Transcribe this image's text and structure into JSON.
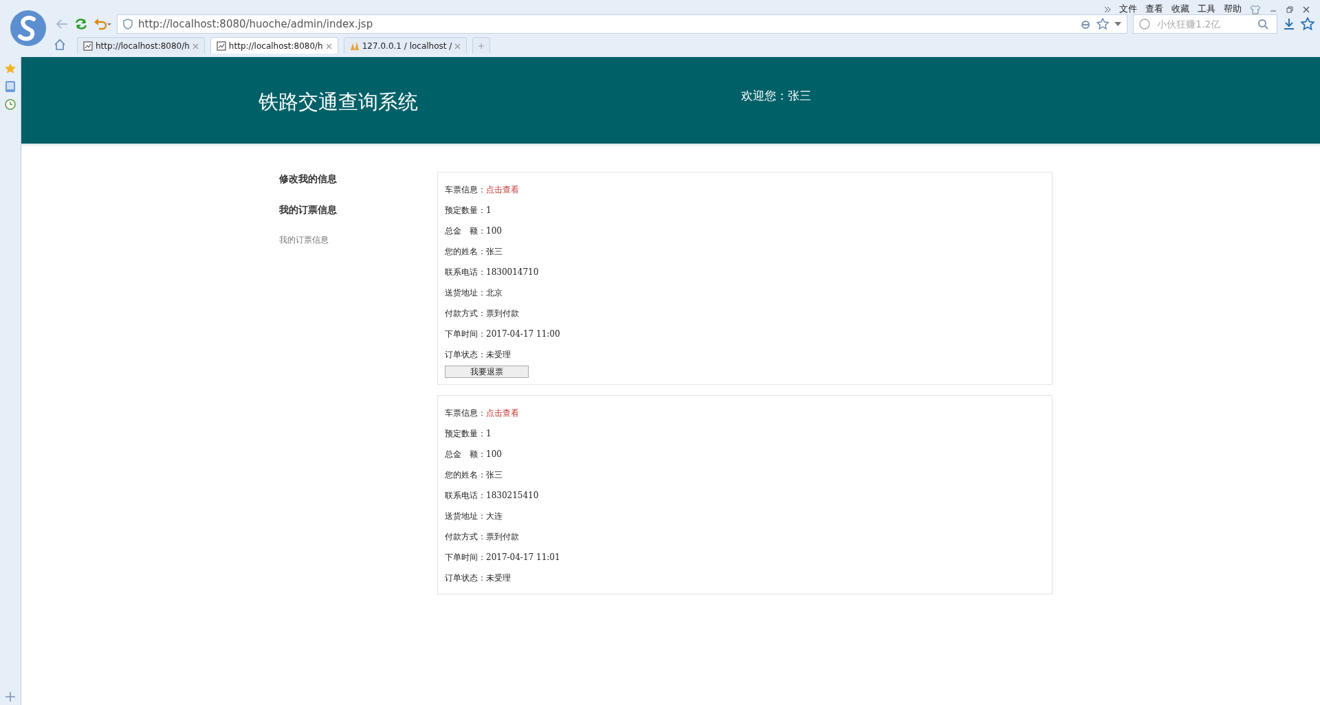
{
  "browser": {
    "menu": [
      "文件",
      "查看",
      "收藏",
      "工具",
      "帮助"
    ],
    "address": "http://localhost:8080/huoche/admin/index.jsp",
    "search": {
      "placeholder": "小伙狂赚1.2亿"
    },
    "tabs": [
      {
        "label": "http://localhost:8080/h",
        "selected": false,
        "kind": "page"
      },
      {
        "label": "http://localhost:8080/h",
        "selected": true,
        "kind": "page"
      },
      {
        "label": "127.0.0.1 / localhost /",
        "selected": false,
        "kind": "pma"
      }
    ]
  },
  "header": {
    "title": "铁路交通查询系统",
    "welcome": "欢迎您：张三"
  },
  "sidebar": [
    {
      "label": "修改我的信息",
      "kind": "heading"
    },
    {
      "label": "我的订票信息",
      "kind": "heading"
    },
    {
      "label": "我的订票信息",
      "kind": "link"
    }
  ],
  "orders": [
    {
      "fields": [
        {
          "label": "车票信息：",
          "value": "点击查看",
          "kind": "link"
        },
        {
          "label": "预定数量：",
          "value": "1",
          "kind": "text"
        },
        {
          "label": "总金　额：",
          "value": "100",
          "kind": "text"
        },
        {
          "label": "您的姓名：",
          "value": "张三",
          "kind": "text"
        },
        {
          "label": "联系电话：",
          "value": "1830014710",
          "kind": "text"
        },
        {
          "label": "送货地址：",
          "value": "北京",
          "kind": "text"
        },
        {
          "label": "付款方式：",
          "value": "票到付款",
          "kind": "text"
        },
        {
          "label": "下单时间：",
          "value": "2017-04-17 11:00",
          "kind": "text"
        },
        {
          "label": "订单状态：",
          "value": "未受理",
          "kind": "text"
        }
      ],
      "button": "我要退票"
    },
    {
      "fields": [
        {
          "label": "车票信息：",
          "value": "点击查看",
          "kind": "link"
        },
        {
          "label": "预定数量：",
          "value": "1",
          "kind": "text"
        },
        {
          "label": "总金　额：",
          "value": "100",
          "kind": "text"
        },
        {
          "label": "您的姓名：",
          "value": "张三",
          "kind": "text"
        },
        {
          "label": "联系电话：",
          "value": "1830215410",
          "kind": "text"
        },
        {
          "label": "送货地址：",
          "value": "大连",
          "kind": "text"
        },
        {
          "label": "付款方式：",
          "value": "票到付款",
          "kind": "text"
        },
        {
          "label": "下单时间：",
          "value": "2017-04-17 11:01",
          "kind": "text"
        },
        {
          "label": "订单状态：",
          "value": "未受理",
          "kind": "text"
        }
      ]
    }
  ]
}
